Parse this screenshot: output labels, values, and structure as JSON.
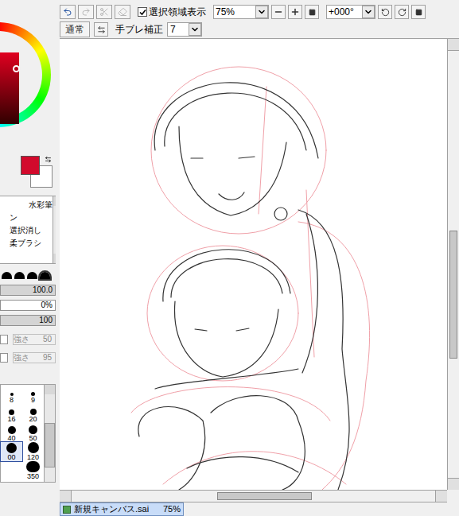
{
  "color_panel": {
    "foreground": "#d20a2c",
    "background": "#ffffff"
  },
  "tools": [
    {
      "label": "水彩筆",
      "selected": false
    },
    {
      "label": "ン",
      "selected": false
    },
    {
      "label": "選択消し",
      "selected": false
    },
    {
      "label": "柔ブラシ",
      "selected": false
    }
  ],
  "brush_shapes": [
    {
      "selected": false
    },
    {
      "selected": false
    },
    {
      "selected": false
    },
    {
      "selected": true
    }
  ],
  "sliders": [
    {
      "reading": "100.0",
      "level": 1
    },
    {
      "reading": "0%",
      "level": 0
    },
    {
      "reading": "100",
      "level": 1
    }
  ],
  "options": [
    {
      "label": "強さ",
      "value": "50",
      "checked": false,
      "disabled": true
    },
    {
      "label": "強さ",
      "value": "95",
      "checked": false,
      "disabled": true
    }
  ],
  "brush_sizes": [
    {
      "label": "8",
      "selected": false
    },
    {
      "label": "9",
      "selected": false
    },
    {
      "label": "16",
      "selected": false
    },
    {
      "label": "20",
      "selected": false
    },
    {
      "label": "40",
      "selected": false
    },
    {
      "label": "50",
      "selected": false
    },
    {
      "label": "00",
      "selected": true
    },
    {
      "label": "120",
      "selected": false
    },
    {
      "label": "350",
      "selected": false
    }
  ],
  "toolbar": {
    "history": [
      {
        "disabled": false
      },
      {
        "disabled": true
      },
      {
        "disabled": true
      },
      {
        "disabled": true
      }
    ],
    "show_selection": {
      "label": "選択領域表示",
      "checked": true
    },
    "zoom": "75%",
    "rotation": "+000°",
    "blend_mode": "通常",
    "stabilizer": {
      "label": "手ブレ補正",
      "value": "7"
    }
  },
  "scroll": {
    "vertical": {
      "level": 0.42
    },
    "horizontal": {
      "level": 0.4
    }
  },
  "documents": [
    {
      "label": "新規キャンバス.sai",
      "zoom": "75%",
      "selected": true
    }
  ]
}
